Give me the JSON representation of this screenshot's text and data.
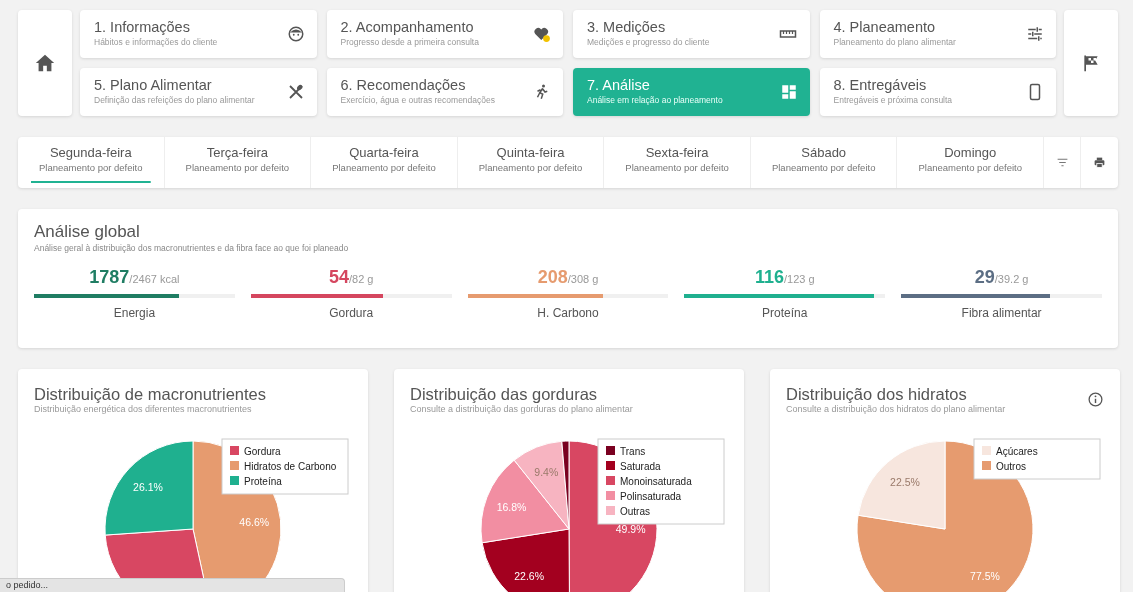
{
  "steps": [
    {
      "title": "1. Informações",
      "subtitle": "Hábitos e informações do cliente",
      "selected": false
    },
    {
      "title": "2. Acompanhamento",
      "subtitle": "Progresso desde a primeira consulta",
      "selected": false
    },
    {
      "title": "3. Medições",
      "subtitle": "Medições e progresso do cliente",
      "selected": false
    },
    {
      "title": "4. Planeamento",
      "subtitle": "Planeamento do plano alimentar",
      "selected": false
    },
    {
      "title": "5. Plano Alimentar",
      "subtitle": "Definição das refeições do plano alimentar",
      "selected": false
    },
    {
      "title": "6. Recomendações",
      "subtitle": "Exercício, água e outras recomendações",
      "selected": false
    },
    {
      "title": "7. Análise",
      "subtitle": "Análise em relação ao planeamento",
      "selected": true
    },
    {
      "title": "8. Entregáveis",
      "subtitle": "Entregáveis e próxima consulta",
      "selected": false
    }
  ],
  "days": [
    {
      "day": "Segunda-feira",
      "plan": "Planeamento por defeito",
      "selected": true
    },
    {
      "day": "Terça-feira",
      "plan": "Planeamento por defeito",
      "selected": false
    },
    {
      "day": "Quarta-feira",
      "plan": "Planeamento por defeito",
      "selected": false
    },
    {
      "day": "Quinta-feira",
      "plan": "Planeamento por defeito",
      "selected": false
    },
    {
      "day": "Sexta-feira",
      "plan": "Planeamento por defeito",
      "selected": false
    },
    {
      "day": "Sábado",
      "plan": "Planeamento por defeito",
      "selected": false
    },
    {
      "day": "Domingo",
      "plan": "Planeamento por defeito",
      "selected": false
    }
  ],
  "global": {
    "title": "Análise global",
    "subtitle": "Análise geral à distribuição dos macronutrientes e da fibra face ao que foi planeado",
    "metrics": [
      {
        "value": "1787",
        "target": "/2467 kcal",
        "label": "Energia",
        "level": 0.724,
        "color": "#1f7d63"
      },
      {
        "value": "54",
        "target": "/82 g",
        "label": "Gordura",
        "level": 0.659,
        "color": "#d5465f"
      },
      {
        "value": "208",
        "target": "/308 g",
        "label": "H. Carbono",
        "level": 0.675,
        "color": "#e69b6f"
      },
      {
        "value": "116",
        "target": "/123 g",
        "label": "Proteína",
        "level": 0.943,
        "color": "#1fb08f"
      },
      {
        "value": "29",
        "target": "/39.2 g",
        "label": "Fibra alimentar",
        "level": 0.74,
        "color": "#5c6e84"
      }
    ]
  },
  "charts": [
    {
      "title": "Distribuição de macronutrientes",
      "subtitle": "Distribuição energética dos diferentes macronutrientes",
      "chart_data": {
        "type": "pie",
        "categories": [
          "Gordura",
          "Hidratos de Carbono",
          "Proteína"
        ],
        "series": [
          {
            "values": [
              27.3,
              46.6,
              26.1
            ]
          }
        ],
        "legend": "top-right",
        "colors": [
          "#d84762",
          "#e69b6f",
          "#1fb08f"
        ],
        "value_labels": [
          null,
          "46.6%",
          "26.1%"
        ]
      }
    },
    {
      "title": "Distribuição das gorduras",
      "subtitle": "Consulte a distribuição das gorduras do plano alimentar",
      "chart_data": {
        "type": "pie",
        "categories": [
          "Trans",
          "Saturada",
          "Monoinsaturada",
          "Polinsaturada",
          "Outras"
        ],
        "series": [
          {
            "values": [
              1.3,
              22.6,
              49.9,
              16.8,
              9.4
            ]
          }
        ],
        "legend": "top-right",
        "colors": [
          "#7a0020",
          "#a3001f",
          "#d84762",
          "#f28ea2",
          "#f7b4c1"
        ],
        "value_labels": [
          null,
          "22.6%",
          "49.9%",
          "16.8%",
          "9.4%"
        ]
      }
    },
    {
      "title": "Distribuição dos hidratos",
      "subtitle": "Consulte a distribuição dos hidratos do plano alimentar",
      "info": true,
      "chart_data": {
        "type": "pie",
        "categories": [
          "Açúcares",
          "Outros"
        ],
        "series": [
          {
            "values": [
              22.5,
              77.5
            ]
          }
        ],
        "legend": "top-right",
        "colors": [
          "#f7e6de",
          "#e69b6f"
        ],
        "value_labels": [
          "22.5%",
          "77.5%"
        ]
      }
    }
  ],
  "status_bar": {
    "text": "o pedido..."
  }
}
